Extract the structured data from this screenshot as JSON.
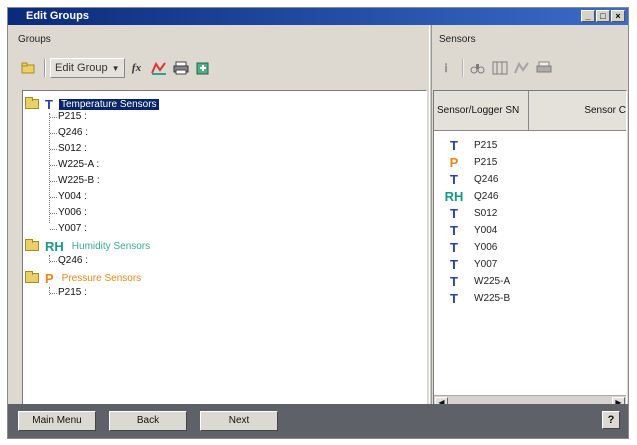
{
  "window": {
    "title": "Edit Groups",
    "buttons": [
      "_",
      "□",
      "×"
    ]
  },
  "groups_panel": {
    "header": "Groups",
    "toolbar": {
      "edit_group_label": "Edit Group",
      "fx_label": "fx"
    },
    "groups": [
      {
        "glyph": "T",
        "color": "#2a3fae",
        "name": "Temperature Sensors",
        "name_color": "#ffffff",
        "selected": true,
        "items": [
          "P215 :",
          "Q246 :",
          "S012 :",
          "W225-A :",
          "W225-B :",
          "Y004 :",
          "Y006 :",
          "Y007 :"
        ]
      },
      {
        "glyph": "RH",
        "color": "#1a9a86",
        "name": "Humidity Sensors",
        "name_color": "#3aa896",
        "selected": false,
        "items": [
          "Q246 :"
        ]
      },
      {
        "glyph": "P",
        "color": "#e8861a",
        "name": "Pressure Sensors",
        "name_color": "#e8861a",
        "selected": false,
        "items": [
          "P215 :"
        ]
      }
    ]
  },
  "sensors_panel": {
    "header": "Sensors",
    "columns": [
      "Sensor/Logger SN",
      "Sensor C"
    ],
    "rows": [
      {
        "glyph": "T",
        "color": "#2a3fae",
        "sn": "P215"
      },
      {
        "glyph": "P",
        "color": "#e8861a",
        "sn": "P215"
      },
      {
        "glyph": "T",
        "color": "#2a3fae",
        "sn": "Q246"
      },
      {
        "glyph": "RH",
        "color": "#1a9a86",
        "sn": "Q246"
      },
      {
        "glyph": "T",
        "color": "#2a3fae",
        "sn": "S012"
      },
      {
        "glyph": "T",
        "color": "#2a3fae",
        "sn": "Y004"
      },
      {
        "glyph": "T",
        "color": "#2a3fae",
        "sn": "Y006"
      },
      {
        "glyph": "T",
        "color": "#2a3fae",
        "sn": "Y007"
      },
      {
        "glyph": "T",
        "color": "#2a3fae",
        "sn": "W225-A"
      },
      {
        "glyph": "T",
        "color": "#2a3fae",
        "sn": "W225-B"
      }
    ]
  },
  "bottom": {
    "main_menu": "Main Menu",
    "back": "Back",
    "next": "Next",
    "help": "?"
  }
}
